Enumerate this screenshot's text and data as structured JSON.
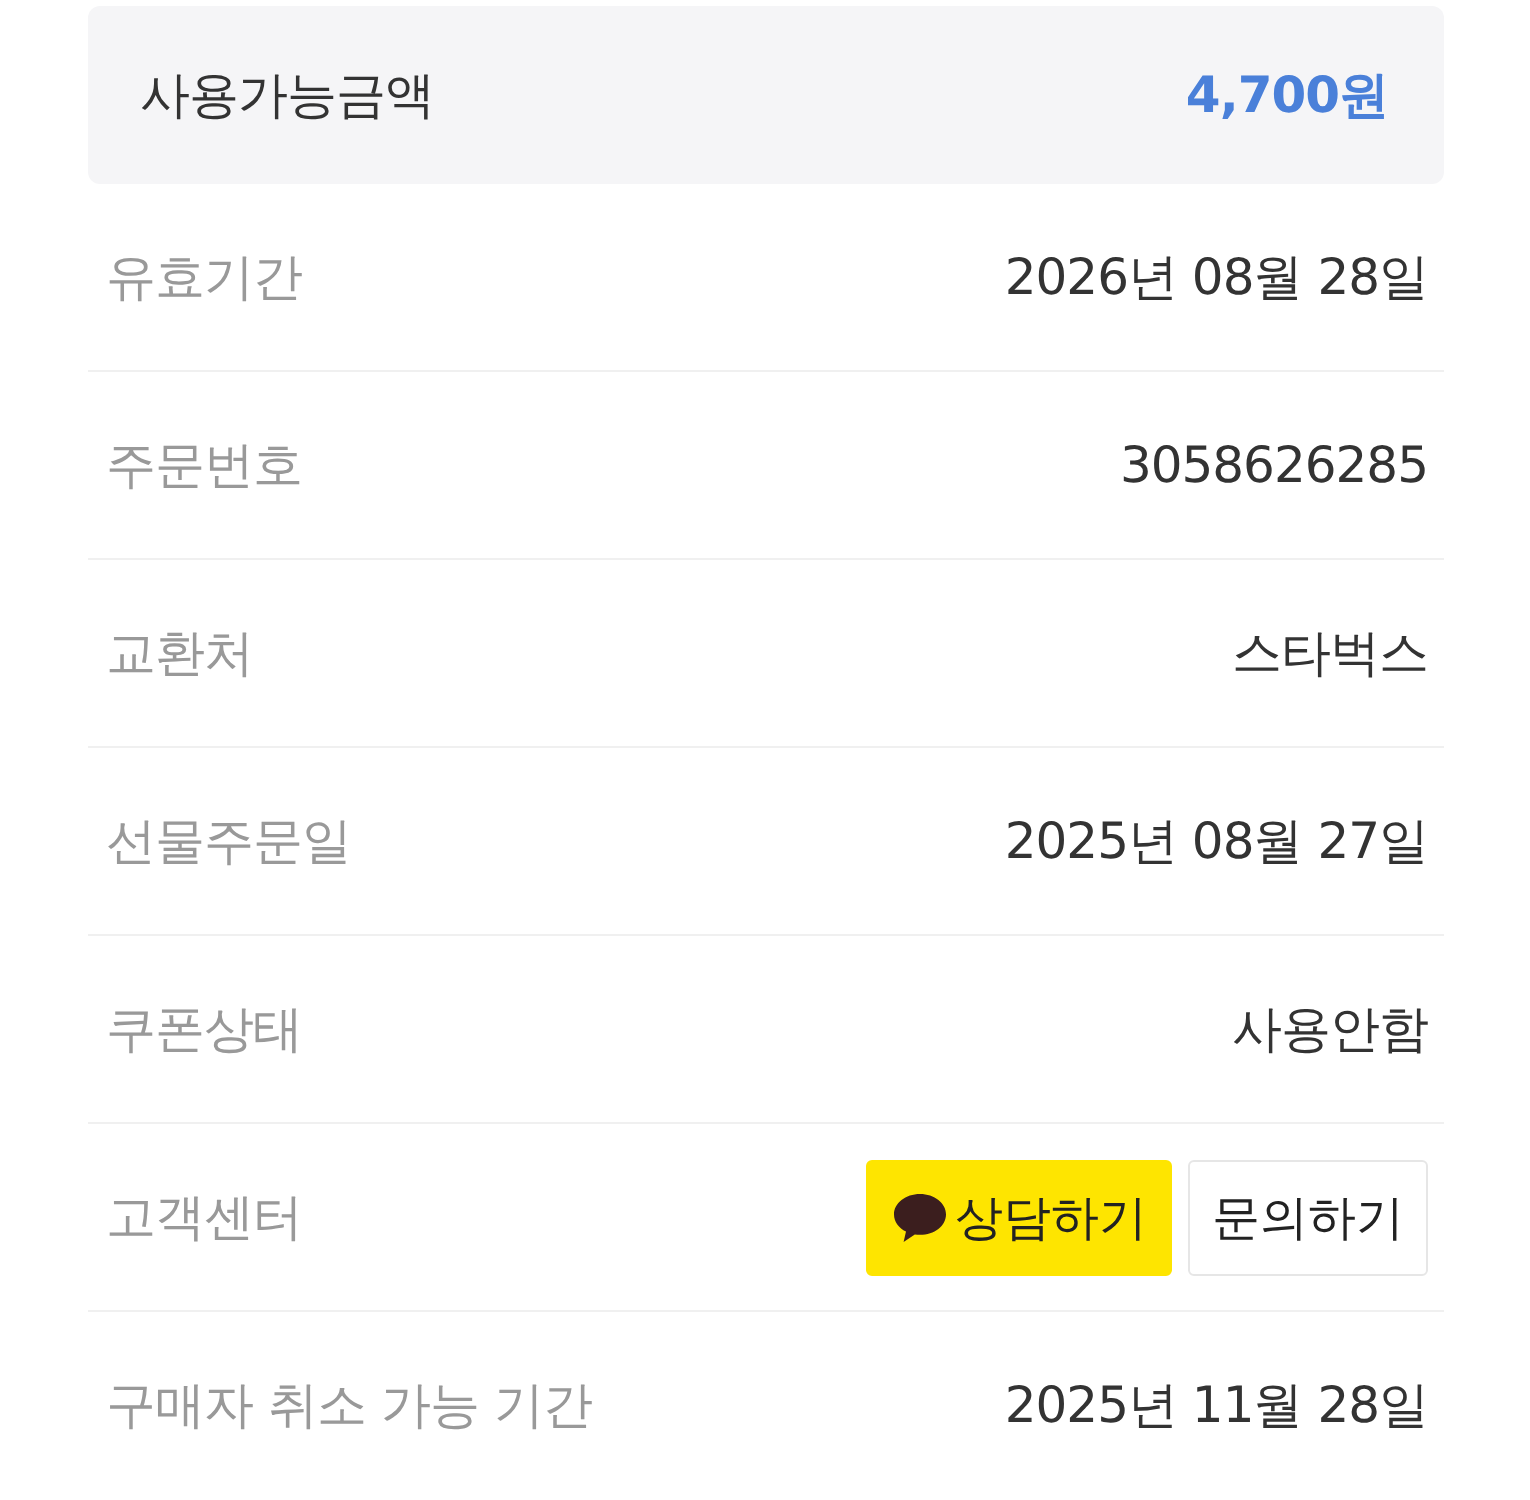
{
  "summary": {
    "label": "사용가능금액",
    "value": "4,700원"
  },
  "details": [
    {
      "kind": "text",
      "label": "유효기간",
      "value": "2026년 08월 28일"
    },
    {
      "kind": "text",
      "label": "주문번호",
      "value": "3058626285"
    },
    {
      "kind": "text",
      "label": "교환처",
      "value": "스타벅스"
    },
    {
      "kind": "text",
      "label": "선물주문일",
      "value": "2025년 08월 27일"
    },
    {
      "kind": "text",
      "label": "쿠폰상태",
      "value": "사용안함"
    },
    {
      "kind": "buttons",
      "label": "고객센터",
      "buttons": [
        {
          "kind": "kakao",
          "label": "상담하기"
        },
        {
          "kind": "plain",
          "label": "문의하기"
        }
      ]
    },
    {
      "kind": "text",
      "label": "구매자 취소 가능 기간",
      "value": "2025년 11월 28일"
    }
  ]
}
